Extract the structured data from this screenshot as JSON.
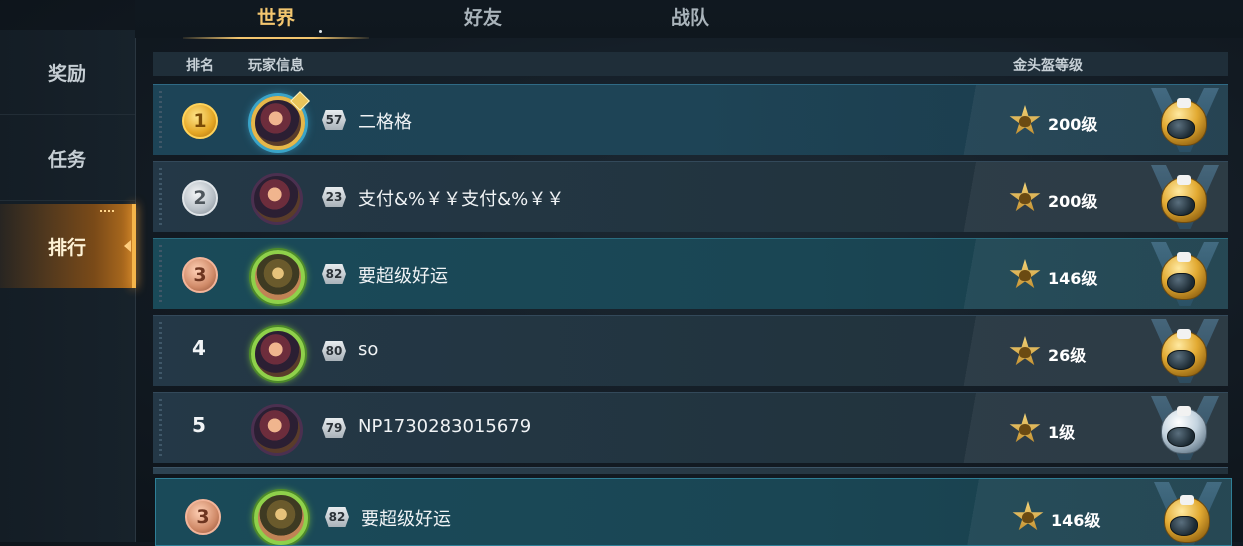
{
  "tabs": [
    {
      "label": "世界"
    },
    {
      "label": "好友"
    },
    {
      "label": "战队"
    }
  ],
  "sidebar": {
    "items": [
      {
        "label": "奖励"
      },
      {
        "label": "任务"
      },
      {
        "label": "排行"
      }
    ]
  },
  "columns": {
    "rank": "排名",
    "player": "玩家信息",
    "helmet": "金头盔等级"
  },
  "rows": [
    {
      "rank": "1",
      "level": "57",
      "name": "二格格",
      "helmet_level": "200级"
    },
    {
      "rank": "2",
      "level": "23",
      "name": "支付&%￥￥支付&%￥￥",
      "helmet_level": "200级"
    },
    {
      "rank": "3",
      "level": "82",
      "name": "要超级好运",
      "helmet_level": "146级"
    },
    {
      "rank": "4",
      "level": "80",
      "name": "so",
      "helmet_level": "26级"
    },
    {
      "rank": "5",
      "level": "79",
      "name": "NP1730283015679",
      "helmet_level": "1级"
    }
  ],
  "my_row": {
    "rank": "3",
    "level": "82",
    "name": "要超级好运",
    "helmet_level": "146级"
  },
  "colors": {
    "accent_gold": "#f3c66f",
    "sidebar_active": "#b9731f",
    "row_highlight": "#1a4a59"
  }
}
